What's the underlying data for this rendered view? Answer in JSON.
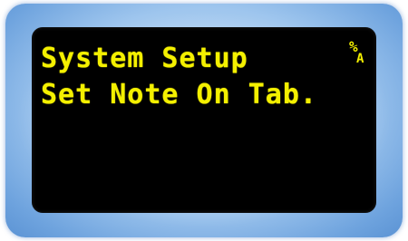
{
  "display": {
    "line1": "System Setup",
    "line2": "Set Note On Tab.",
    "indicator_top": "%",
    "indicator_bottom": "A"
  },
  "colors": {
    "text": "#f4f000",
    "screen": "#000000",
    "frame": "#9fc6ee"
  }
}
